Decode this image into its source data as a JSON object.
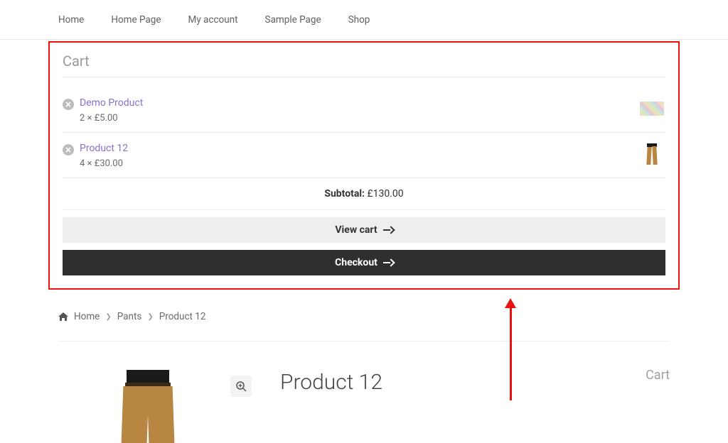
{
  "nav": {
    "items": [
      {
        "label": "Home"
      },
      {
        "label": "Home Page"
      },
      {
        "label": "My account"
      },
      {
        "label": "Sample Page"
      },
      {
        "label": "Shop"
      }
    ]
  },
  "cart_widget": {
    "title": "Cart",
    "items": [
      {
        "name": "Demo Product",
        "qty": "2",
        "price": "£5.00",
        "thumb": "tile"
      },
      {
        "name": "Product 12",
        "qty": "4",
        "price": "£30.00",
        "thumb": "pants"
      }
    ],
    "subtotal_label": "Subtotal:",
    "subtotal_value": "£130.00",
    "view_cart_label": "View cart",
    "checkout_label": "Checkout"
  },
  "breadcrumb": {
    "home": "Home",
    "cat": "Pants",
    "current": "Product 12"
  },
  "product": {
    "title": "Product 12"
  },
  "sidebar": {
    "cart_title": "Cart"
  }
}
